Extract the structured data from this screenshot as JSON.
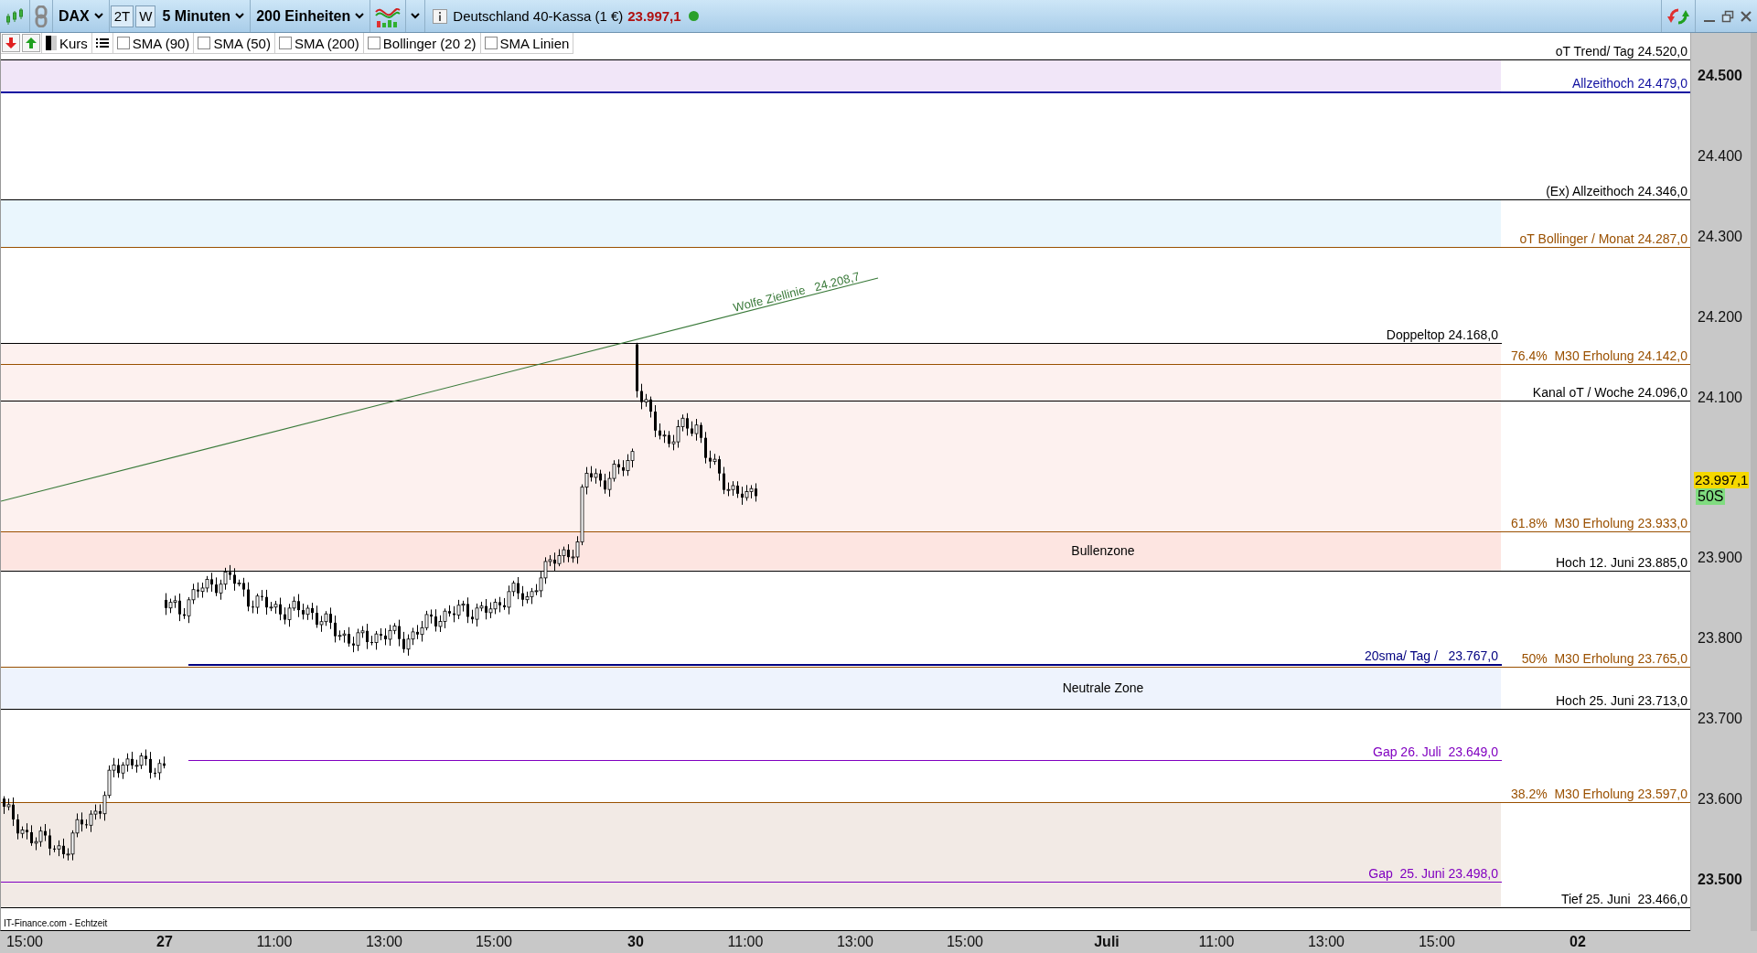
{
  "toolbar": {
    "symbol": "DAX",
    "range_buttons": [
      {
        "label": "2T",
        "selected": false
      },
      {
        "label": "W",
        "selected": false
      }
    ],
    "interval": "5 Minuten",
    "units": "200 Einheiten",
    "instrument": "Deutschland 40-Kassa (1 €)",
    "price": "23.997,1",
    "live": true
  },
  "legend": {
    "price_label": "Kurs",
    "indicators": [
      {
        "label": "SMA (90)",
        "checked": false
      },
      {
        "label": "SMA (50)",
        "checked": false
      },
      {
        "label": "SMA (200)",
        "checked": false
      },
      {
        "label": "Bollinger (20 2)",
        "checked": false
      },
      {
        "label": "SMA Linien",
        "checked": false
      }
    ]
  },
  "zones": [
    {
      "color": "#f1e6f8"
    },
    {
      "color": "#eaf6fd"
    },
    {
      "color": "#fdf1ef"
    },
    {
      "color": "#fde5e1",
      "label": "Bullenzone"
    },
    {
      "color": "#eef3fd",
      "label": "Neutrale Zone"
    },
    {
      "color": "#f2eae5"
    }
  ],
  "levels": [
    {
      "label": "oT Trend/ Tag 24.520,0",
      "color": "#000000",
      "kind": "full"
    },
    {
      "label": "Allzeithoch 24.479,0",
      "color": "#1010a0",
      "kind": "full"
    },
    {
      "label": "(Ex) Allzeithoch 24.346,0",
      "color": "#000000",
      "kind": "full"
    },
    {
      "label": "oT Bollinger / Monat 24.287,0",
      "color": "#9a5000",
      "kind": "full"
    },
    {
      "label": "Doppeltop 24.168,0",
      "color": "#000000",
      "kind": "left"
    },
    {
      "label": "76.4%  M30 Erholung 24.142,0",
      "color": "#9a5000",
      "kind": "full"
    },
    {
      "label": "Kanal oT / Woche 24.096,0",
      "color": "#000000",
      "kind": "full"
    },
    {
      "label": "61.8%  M30 Erholung 23.933,0",
      "color": "#9a5000",
      "kind": "full"
    },
    {
      "label": "Hoch 12. Juni 23.885,0",
      "color": "#000000",
      "kind": "full"
    },
    {
      "label": "20sma/ Tag /   23.767,0",
      "color": "#000080",
      "kind": "mid"
    },
    {
      "label": "50%  M30 Erholung 23.765,0",
      "color": "#9a5000",
      "kind": "full"
    },
    {
      "label": "Hoch 25. Juni 23.713,0",
      "color": "#000000",
      "kind": "full"
    },
    {
      "label": "Gap 26. Juli  23.649,0",
      "color": "#8000c0",
      "kind": "mid"
    },
    {
      "label": "38.2%  M30 Erholung 23.597,0",
      "color": "#9a5000",
      "kind": "full"
    },
    {
      "label": "Gap  25. Juni 23.498,0",
      "color": "#8000c0",
      "kind": "left"
    },
    {
      "label": "Tief 25. Juni  23.466,0",
      "color": "#000000",
      "kind": "full"
    }
  ],
  "trend_line": {
    "label": "Wolfe Ziellinie   24.208,7"
  },
  "source": "IT-Finance.com - Echtzeit",
  "price_axis": [
    {
      "label": "24.500",
      "kind": "major"
    },
    {
      "label": "24.400",
      "kind": "minor"
    },
    {
      "label": "24.300",
      "kind": "minor"
    },
    {
      "label": "24.200",
      "kind": "minor"
    },
    {
      "label": "24.100",
      "kind": "minor"
    },
    {
      "label": "23.900",
      "kind": "minor"
    },
    {
      "label": "23.800",
      "kind": "minor"
    },
    {
      "label": "23.700",
      "kind": "minor"
    },
    {
      "label": "23.600",
      "kind": "minor"
    },
    {
      "label": "23.500",
      "kind": "major"
    }
  ],
  "current_price": {
    "value": "23.997,1",
    "tag": "50S"
  },
  "time_axis": [
    {
      "label": "15:00",
      "kind": "hour"
    },
    {
      "label": "27",
      "kind": "day"
    },
    {
      "label": "11:00",
      "kind": "hour"
    },
    {
      "label": "13:00",
      "kind": "hour"
    },
    {
      "label": "15:00",
      "kind": "hour"
    },
    {
      "label": "30",
      "kind": "day"
    },
    {
      "label": "11:00",
      "kind": "hour"
    },
    {
      "label": "13:00",
      "kind": "hour"
    },
    {
      "label": "15:00",
      "kind": "hour"
    },
    {
      "label": "Juli",
      "kind": "day"
    },
    {
      "label": "11:00",
      "kind": "hour"
    },
    {
      "label": "13:00",
      "kind": "hour"
    },
    {
      "label": "15:00",
      "kind": "hour"
    },
    {
      "label": "02",
      "kind": "day"
    }
  ]
}
